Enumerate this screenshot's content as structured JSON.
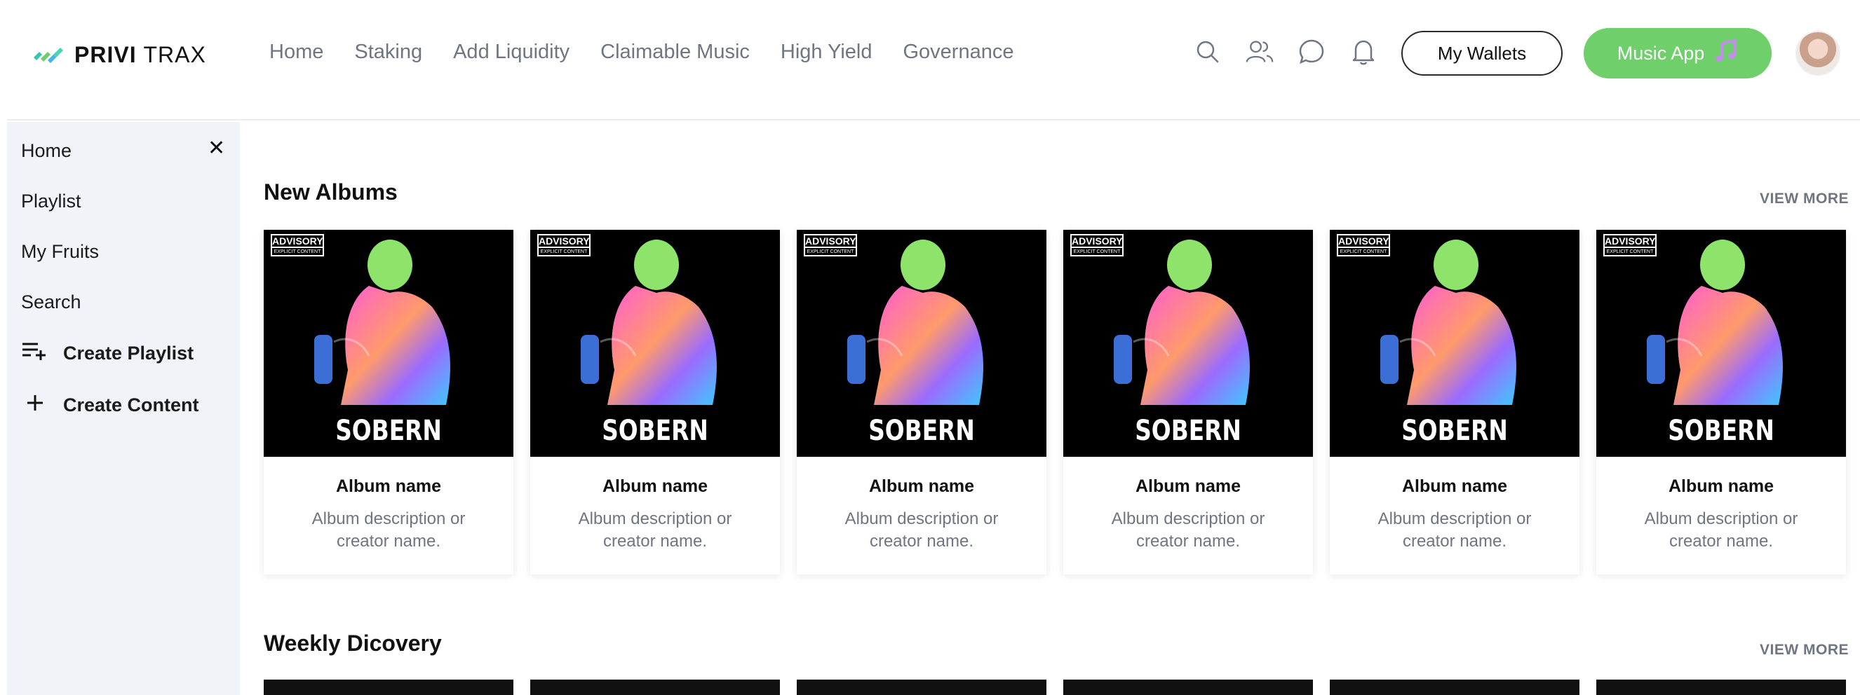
{
  "header": {
    "logo_bold": "PRIVI",
    "logo_light": "TRAX",
    "nav": [
      "Home",
      "Staking",
      "Add Liquidity",
      "Claimable Music",
      "High Yield",
      "Governance"
    ],
    "wallets_label": "My Wallets",
    "music_app_label": "Music App",
    "icons": [
      "search-icon",
      "people-icon",
      "chat-icon",
      "bell-icon",
      "music-note-icon"
    ]
  },
  "sidebar": {
    "items": [
      {
        "label": "Home"
      },
      {
        "label": "Playlist"
      },
      {
        "label": "My Fruits"
      },
      {
        "label": "Search"
      }
    ],
    "create_playlist": "Create Playlist",
    "create_content": "Create Content",
    "close": "✕"
  },
  "sections": [
    {
      "title": "New Albums",
      "view_more": "VIEW MORE",
      "albums": [
        {
          "name": "Album name",
          "description": "Album description or creator name.",
          "cover_title": "SOBERN",
          "advisory": "ADVISORY",
          "advisory_sub": "EXPLICIT CONTENT"
        },
        {
          "name": "Album name",
          "description": "Album description or creator name.",
          "cover_title": "SOBERN",
          "advisory": "ADVISORY",
          "advisory_sub": "EXPLICIT CONTENT"
        },
        {
          "name": "Album name",
          "description": "Album description or creator name.",
          "cover_title": "SOBERN",
          "advisory": "ADVISORY",
          "advisory_sub": "EXPLICIT CONTENT"
        },
        {
          "name": "Album name",
          "description": "Album description or creator name.",
          "cover_title": "SOBERN",
          "advisory": "ADVISORY",
          "advisory_sub": "EXPLICIT CONTENT"
        },
        {
          "name": "Album name",
          "description": "Album description or creator name.",
          "cover_title": "SOBERN",
          "advisory": "ADVISORY",
          "advisory_sub": "EXPLICIT CONTENT"
        },
        {
          "name": "Album name",
          "description": "Album description or creator name.",
          "cover_title": "SOBERN",
          "advisory": "ADVISORY",
          "advisory_sub": "EXPLICIT CONTENT"
        }
      ]
    },
    {
      "title": "Weekly Dicovery",
      "view_more": "VIEW MORE"
    }
  ],
  "colors": {
    "accent_green": "#6fcf6a",
    "nav_gray": "#707582",
    "sidebar_bg": "#f2f3f8"
  }
}
